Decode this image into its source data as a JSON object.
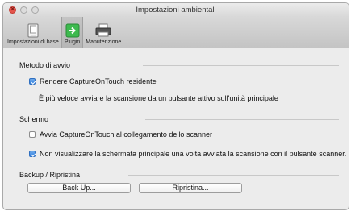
{
  "window": {
    "title": "Impostazioni ambientali"
  },
  "toolbar": {
    "items": [
      {
        "label": "Impostazioni di base",
        "icon": "basic-settings-icon"
      },
      {
        "label": "Plugin",
        "icon": "plugin-icon"
      },
      {
        "label": "Manutenzione",
        "icon": "printer-icon"
      }
    ]
  },
  "startup": {
    "heading": "Metodo di avvio",
    "resident_label": "Rendere CaptureOnTouch residente",
    "resident_checked": true,
    "note": "È più veloce avviare la scansione da un pulsante attivo sull'unità principale"
  },
  "screen": {
    "heading": "Schermo",
    "autostart_label": "Avvia CaptureOnTouch al collegamento dello scanner",
    "autostart_checked": false,
    "hide_main_label": "Non visualizzare la schermata principale una volta avviata la scansione con il pulsante scanner.",
    "hide_main_checked": true
  },
  "backup": {
    "heading": "Backup / Ripristina",
    "backup_button": "Back Up...",
    "restore_button": "Ripristina..."
  },
  "colors": {
    "plugin_green": "#3dba4e",
    "checkbox_blue": "#2f7fe0"
  }
}
